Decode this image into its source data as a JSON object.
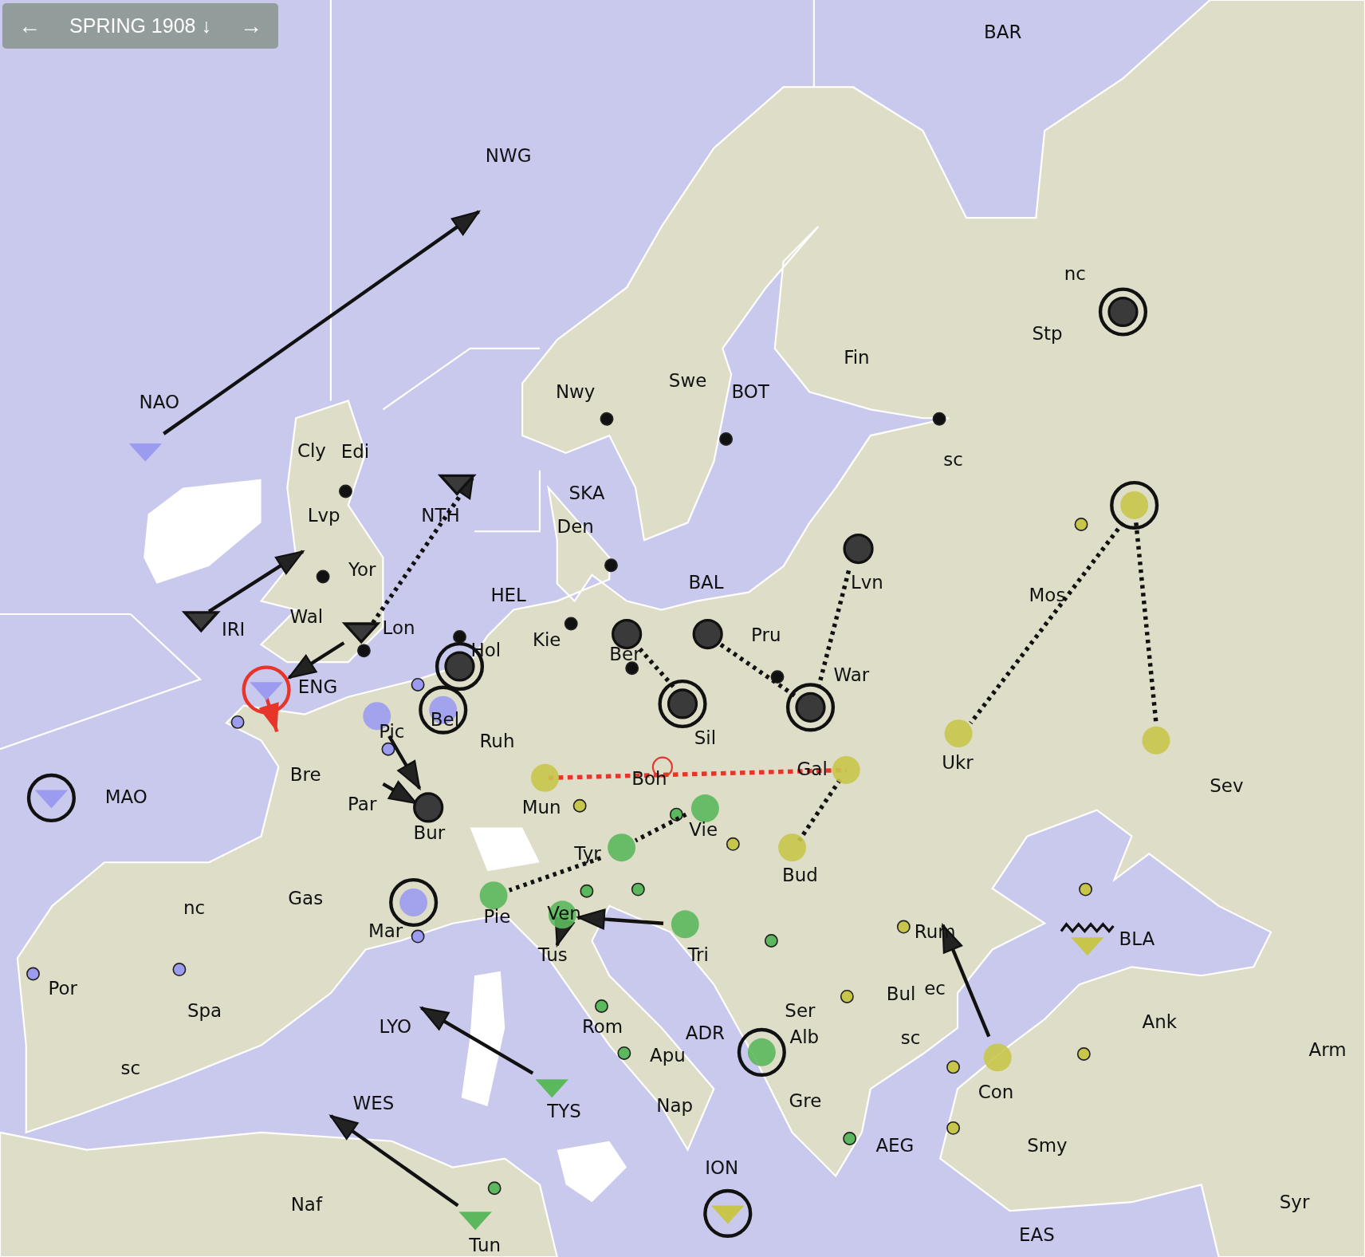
{
  "header": {
    "prev": "←",
    "title": "SPRING 1908",
    "title_arrow": "↓",
    "next": "→"
  },
  "map": {
    "labels": [
      "BAR",
      "NWG",
      "nc",
      "Stp",
      "Fin",
      "NAO",
      "Nwy",
      "Swe",
      "BOT",
      "Cly",
      "Edi",
      "sc",
      "SKA",
      "Lvp",
      "NTH",
      "Den",
      "Yor",
      "HEL",
      "BAL",
      "Lvn",
      "Mos",
      "IRI",
      "Wal",
      "Lon",
      "Hol",
      "Kie",
      "Ber",
      "Pru",
      "ENG",
      "War",
      "Pic",
      "Bel",
      "Ruh",
      "Sil",
      "Bre",
      "Boh",
      "Gal",
      "Ukr",
      "Sev",
      "MAO",
      "Par",
      "Mun",
      "Bur",
      "Vie",
      "Tyr",
      "Bud",
      "nc",
      "Gas",
      "Pie",
      "Ven",
      "Mar",
      "Rum",
      "BLA",
      "Tus",
      "Tri",
      "Por",
      "Bul",
      "ec",
      "Spa",
      "Ser",
      "LYO",
      "Rom",
      "ADR",
      "Alb",
      "sc",
      "Ank",
      "Apu",
      "Arm",
      "sc",
      "Con",
      "WES",
      "TYS",
      "Nap",
      "Gre",
      "AEG",
      "Smy",
      "ION",
      "Naf",
      "Syr",
      "Tun",
      "EAS"
    ],
    "units": [
      {
        "kind": "army",
        "color": "#3a3a3a",
        "ringed": true,
        "dislodged": false,
        "convoying": false
      },
      {
        "kind": "army",
        "color": "#3a3a3a",
        "ringed": false,
        "dislodged": false,
        "convoying": false
      },
      {
        "kind": "army",
        "color": "#3a3a3a",
        "ringed": false,
        "dislodged": false,
        "convoying": false
      },
      {
        "kind": "army",
        "color": "#3a3a3a",
        "ringed": false,
        "dislodged": false,
        "convoying": false
      },
      {
        "kind": "army",
        "color": "#3a3a3a",
        "ringed": true,
        "dislodged": false,
        "convoying": false
      },
      {
        "kind": "army",
        "color": "#3a3a3a",
        "ringed": true,
        "dislodged": false,
        "convoying": false
      },
      {
        "kind": "army",
        "color": "#3a3a3a",
        "ringed": true,
        "dislodged": false,
        "convoying": false
      },
      {
        "kind": "army",
        "color": "#3a3a3a",
        "ringed": false,
        "dislodged": false,
        "convoying": false
      },
      {
        "kind": "army",
        "color": "#9b9cf0",
        "ringed": false,
        "dislodged": false,
        "convoying": false
      },
      {
        "kind": "army",
        "color": "#9b9cf0",
        "ringed": true,
        "dislodged": false,
        "convoying": false
      },
      {
        "kind": "army",
        "color": "#9b9cf0",
        "ringed": true,
        "dislodged": false,
        "convoying": false
      },
      {
        "kind": "army",
        "color": "#c8c64a",
        "ringed": true,
        "dislodged": false,
        "convoying": false
      },
      {
        "kind": "army",
        "color": "#c8c64a",
        "ringed": false,
        "dislodged": false,
        "convoying": false
      },
      {
        "kind": "army",
        "color": "#c8c64a",
        "ringed": false,
        "dislodged": false,
        "convoying": false
      },
      {
        "kind": "army",
        "color": "#c8c64a",
        "ringed": false,
        "dislodged": false,
        "convoying": false
      },
      {
        "kind": "army",
        "color": "#c8c64a",
        "ringed": false,
        "dislodged": false,
        "convoying": false
      },
      {
        "kind": "army",
        "color": "#c8c64a",
        "ringed": false,
        "dislodged": false,
        "convoying": false
      },
      {
        "kind": "army",
        "color": "#c8c64a",
        "ringed": false,
        "dislodged": false,
        "convoying": false
      },
      {
        "kind": "army",
        "color": "#5cb85c",
        "ringed": false,
        "dislodged": false,
        "convoying": false
      },
      {
        "kind": "army",
        "color": "#5cb85c",
        "ringed": false,
        "dislodged": false,
        "convoying": false
      },
      {
        "kind": "army",
        "color": "#5cb85c",
        "ringed": false,
        "dislodged": false,
        "convoying": false
      },
      {
        "kind": "army",
        "color": "#5cb85c",
        "ringed": false,
        "dislodged": false,
        "convoying": false
      },
      {
        "kind": "army",
        "color": "#5cb85c",
        "ringed": false,
        "dislodged": false,
        "convoying": false
      },
      {
        "kind": "army",
        "color": "#5cb85c",
        "ringed": true,
        "dislodged": false,
        "convoying": false
      },
      {
        "kind": "fleet",
        "color": "#9b9cf0",
        "ringed": false,
        "dislodged": false,
        "convoying": false
      },
      {
        "kind": "fleet",
        "color": "#9b9cf0",
        "ringed": true,
        "dislodged": false,
        "convoying": false
      },
      {
        "kind": "fleet",
        "color": "#9b9cf0",
        "ringed": false,
        "dislodged": true,
        "convoying": false
      },
      {
        "kind": "fleet",
        "color": "#3a3a3a",
        "ringed": false,
        "dislodged": false,
        "convoying": false
      },
      {
        "kind": "fleet",
        "color": "#3a3a3a",
        "ringed": false,
        "dislodged": false,
        "convoying": false
      },
      {
        "kind": "fleet",
        "color": "#3a3a3a",
        "ringed": false,
        "dislodged": false,
        "convoying": false
      },
      {
        "kind": "fleet",
        "color": "#5cb85c",
        "ringed": false,
        "dislodged": false,
        "convoying": false
      },
      {
        "kind": "fleet",
        "color": "#5cb85c",
        "ringed": false,
        "dislodged": false,
        "convoying": false
      },
      {
        "kind": "fleet",
        "color": "#c8c64a",
        "ringed": false,
        "dislodged": false,
        "convoying": true
      },
      {
        "kind": "fleet",
        "color": "#c8c64a",
        "ringed": true,
        "dislodged": false,
        "convoying": false
      }
    ],
    "centers": [
      {
        "color": "#111111"
      },
      {
        "color": "#111111"
      },
      {
        "color": "#111111"
      },
      {
        "color": "#111111"
      },
      {
        "color": "#111111"
      },
      {
        "color": "#111111"
      },
      {
        "color": "#111111"
      },
      {
        "color": "#111111"
      },
      {
        "color": "#111111"
      },
      {
        "color": "#111111"
      },
      {
        "color": "#111111"
      },
      {
        "color": "#9b9cf0"
      },
      {
        "color": "#9b9cf0"
      },
      {
        "color": "#9b9cf0"
      },
      {
        "color": "#9b9cf0"
      },
      {
        "color": "#9b9cf0"
      },
      {
        "color": "#9b9cf0"
      },
      {
        "color": "#c8c64a"
      },
      {
        "color": "#c8c64a"
      },
      {
        "color": "#c8c64a"
      },
      {
        "color": "#c8c64a"
      },
      {
        "color": "#c8c64a"
      },
      {
        "color": "#c8c64a"
      },
      {
        "color": "#c8c64a"
      },
      {
        "color": "#c8c64a"
      },
      {
        "color": "#c8c64a"
      },
      {
        "color": "#5cb85c"
      },
      {
        "color": "#5cb85c"
      },
      {
        "color": "#5cb85c"
      },
      {
        "color": "#5cb85c"
      },
      {
        "color": "#5cb85c"
      },
      {
        "color": "#5cb85c"
      },
      {
        "color": "#5cb85c"
      },
      {
        "color": "#5cb85c"
      }
    ],
    "orders": [
      {
        "kind": "move"
      },
      {
        "kind": "move"
      },
      {
        "kind": "move"
      },
      {
        "kind": "support_move"
      },
      {
        "kind": "move"
      },
      {
        "kind": "move"
      },
      {
        "kind": "move"
      },
      {
        "kind": "move"
      },
      {
        "kind": "move"
      },
      {
        "kind": "move"
      },
      {
        "kind": "move"
      },
      {
        "kind": "support"
      },
      {
        "kind": "support"
      },
      {
        "kind": "support"
      },
      {
        "kind": "support"
      },
      {
        "kind": "support"
      },
      {
        "kind": "support"
      },
      {
        "kind": "support"
      },
      {
        "kind": "support"
      },
      {
        "kind": "failed"
      },
      {
        "kind": "retreat"
      }
    ]
  }
}
